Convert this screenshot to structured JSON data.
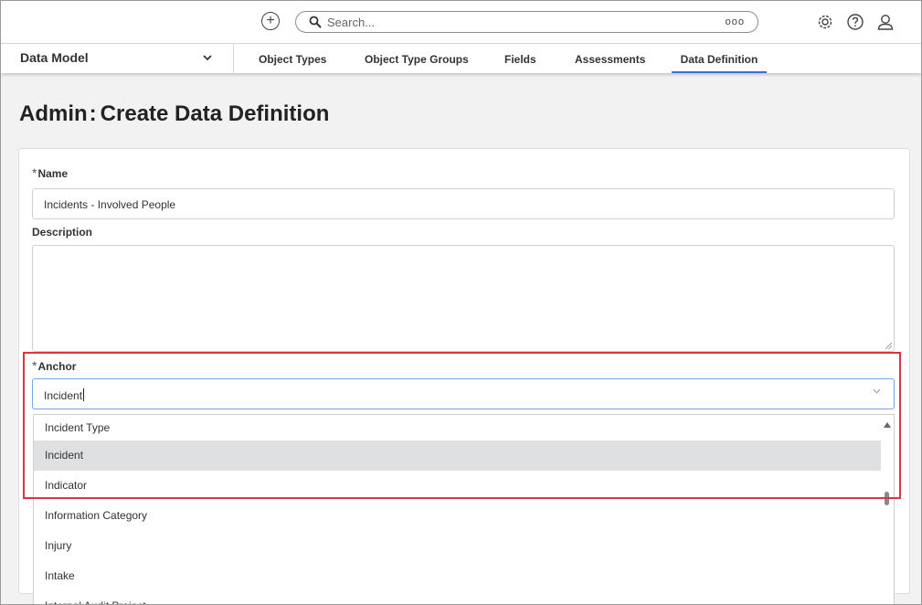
{
  "topbar": {
    "add_icon": "plus-circle-icon",
    "search": {
      "placeholder": "Search...",
      "more_label": "ooo"
    },
    "icons": [
      "gear-icon",
      "help-icon",
      "user-icon"
    ]
  },
  "nav": {
    "section_title": "Data Model",
    "tabs": [
      {
        "label": "Object Types"
      },
      {
        "label": "Object Type Groups"
      },
      {
        "label": "Fields"
      },
      {
        "label": "Assessments"
      },
      {
        "label": "Data Definition"
      }
    ],
    "active_tab": "Data Definition"
  },
  "page": {
    "title_prefix": "Admin",
    "title_sep": ":",
    "title_main": "Create Data Definition"
  },
  "form": {
    "required_mark": "*",
    "name_label": "Name",
    "name_value": "Incidents - Involved People",
    "description_label": "Description",
    "description_value": "",
    "anchor_label": "Anchor",
    "anchor_value": "Incident"
  },
  "dropdown": {
    "options": [
      "Incident Type",
      "Incident",
      "Indicator",
      "Information Category",
      "Injury",
      "Intake",
      "Internal Audit Project"
    ],
    "selected_index": 1,
    "scroll_position": 0.45
  },
  "colors": {
    "accent": "#3a6fd8",
    "highlight": "#e0343a",
    "selected_option": "#dfe0e2"
  }
}
